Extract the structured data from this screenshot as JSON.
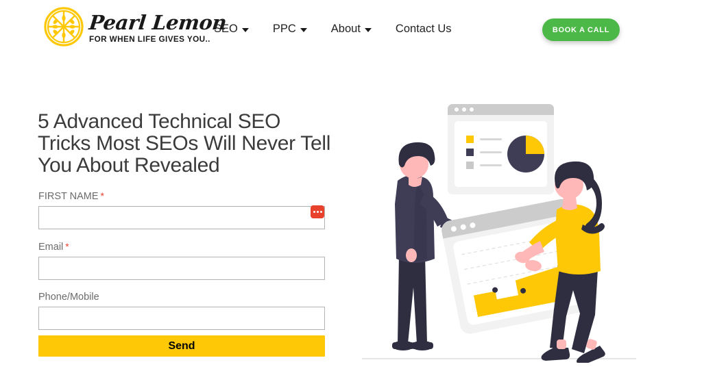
{
  "header": {
    "logo": {
      "icon": "lemon-slice-icon",
      "word": "Pearl Lemon",
      "tagline": "FOR WHEN LIFE GIVES YOU..",
      "color": "#FFC806"
    },
    "nav": [
      {
        "label": "SEO",
        "has_dropdown": true,
        "icon": "chevron-down-icon"
      },
      {
        "label": "PPC",
        "has_dropdown": true,
        "icon": "chevron-down-icon"
      },
      {
        "label": "About",
        "has_dropdown": true,
        "icon": "chevron-down-icon"
      },
      {
        "label": "Contact Us",
        "has_dropdown": false
      }
    ],
    "cta": {
      "label": "BOOK A CALL",
      "color": "#4cb847"
    }
  },
  "hero": {
    "heading": "5 Advanced Technical SEO Tricks Most SEOs Will  Never Tell You About  Revealed"
  },
  "form": {
    "fields": [
      {
        "label": "FIRST NAME",
        "required": true,
        "value": "",
        "placeholder": "",
        "badge": "autofill-badge",
        "badge_color": "#e8412c"
      },
      {
        "label": "Email",
        "required": true,
        "value": "",
        "placeholder": ""
      },
      {
        "label": "Phone/Mobile",
        "required": false,
        "value": "",
        "placeholder": ""
      }
    ],
    "required_marker": "*",
    "submit": {
      "label": "Send",
      "color": "#FFC806"
    }
  },
  "illustration": {
    "name": "seo-analytics-illustration",
    "browser_card": {
      "name": "pie-chart-browser-window",
      "dots": 3,
      "legend_swatches": [
        "#FFC806",
        "#3f3d56",
        "#c9c9c9"
      ],
      "pie_slices": [
        {
          "color": "#FFC806",
          "portion": 25
        },
        {
          "color": "#3f3d56",
          "portion": 75
        }
      ]
    },
    "people": [
      {
        "name": "man-figure",
        "suit_color": "#3f3d56",
        "skin": "#ffb8b8"
      },
      {
        "name": "woman-figure",
        "shirt_color": "#FFC806",
        "hair_color": "#2f2e41",
        "skin": "#ffb8b8"
      }
    ],
    "tilted_window": {
      "name": "area-chart-window",
      "chart_color": "#FFC806",
      "marker_color": "#2f2e41",
      "markers": 3
    },
    "ground_line_color": "#e6e6e6"
  }
}
